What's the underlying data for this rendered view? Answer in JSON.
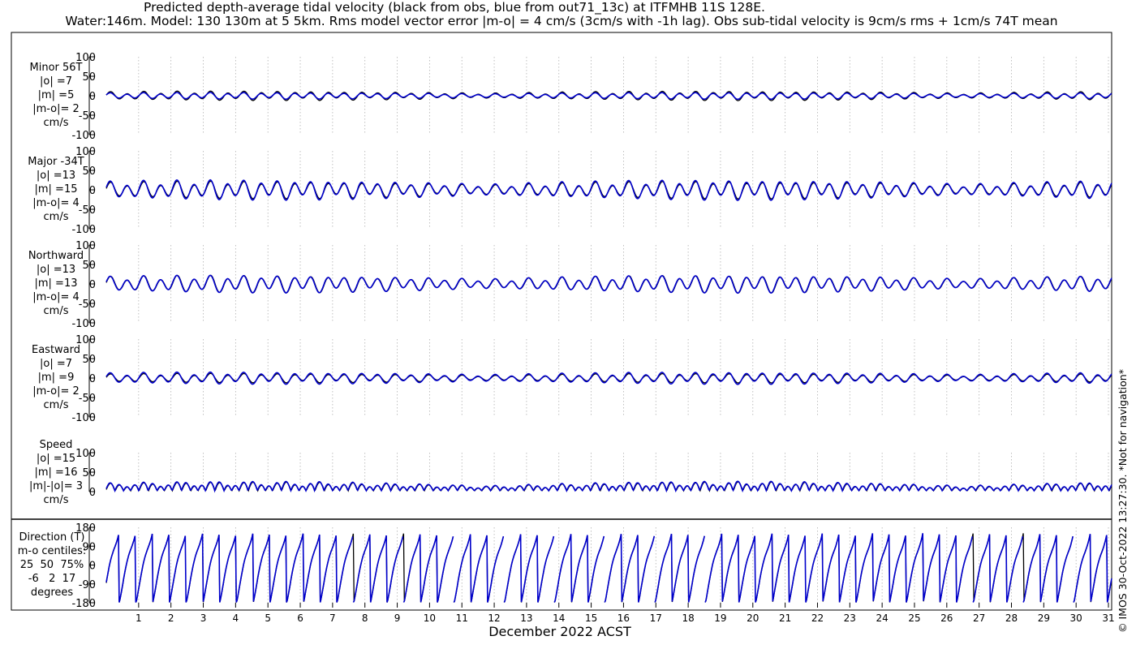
{
  "header": {
    "title_line1": "Predicted depth-average tidal velocity (black from obs, blue from out71_13c) at ITFMHB 11S 128E.",
    "title_line2": "Water:146m. Model: 130 130m at 5 5km. Rms model vector error |m-o| = 4 cm/s (3cm/s with -1h lag). Obs sub-tidal velocity is 9cm/s rms + 1cm/s 74T mean"
  },
  "xlabel": "December 2022 ACST",
  "copyright": "© IMOS 30-Oct-2022 13:27:30. *Not for navigation*",
  "colors": {
    "obs": "#000000",
    "model": "#0000cc",
    "grid": "#b0b0b0"
  },
  "chart_data": [
    {
      "type": "line",
      "id": "minor",
      "label_lines": [
        "Minor 56T",
        "|o| =7",
        "|m| =5",
        "|m-o|= 2",
        "cm/s"
      ],
      "ylim": [
        -100,
        100
      ],
      "yticks": [
        100,
        50,
        0,
        -50,
        -100
      ],
      "xlim": [
        0,
        31.1
      ],
      "xticks": [
        1,
        2,
        3,
        4,
        5,
        6,
        7,
        8,
        9,
        10,
        11,
        12,
        13,
        14,
        15,
        16,
        17,
        18,
        19,
        20,
        21,
        22,
        23,
        24,
        25,
        26,
        27,
        28,
        29,
        30,
        31
      ],
      "series": [
        {
          "name": "obs",
          "rms": 7
        },
        {
          "name": "model",
          "rms": 5
        }
      ]
    },
    {
      "type": "line",
      "id": "major",
      "label_lines": [
        "Major -34T",
        "|o| =13",
        "|m| =15",
        "|m-o|= 4",
        "cm/s"
      ],
      "ylim": [
        -100,
        100
      ],
      "yticks": [
        100,
        50,
        0,
        -50,
        -100
      ],
      "xlim": [
        0,
        31.1
      ],
      "xticks": [
        1,
        2,
        3,
        4,
        5,
        6,
        7,
        8,
        9,
        10,
        11,
        12,
        13,
        14,
        15,
        16,
        17,
        18,
        19,
        20,
        21,
        22,
        23,
        24,
        25,
        26,
        27,
        28,
        29,
        30,
        31
      ],
      "series": [
        {
          "name": "obs",
          "rms": 13
        },
        {
          "name": "model",
          "rms": 15
        }
      ]
    },
    {
      "type": "line",
      "id": "north",
      "label_lines": [
        "Northward",
        "|o| =13",
        "|m| =13",
        "|m-o|= 4",
        "cm/s"
      ],
      "ylim": [
        -100,
        100
      ],
      "yticks": [
        100,
        50,
        0,
        -50,
        -100
      ],
      "xlim": [
        0,
        31.1
      ],
      "xticks": [
        1,
        2,
        3,
        4,
        5,
        6,
        7,
        8,
        9,
        10,
        11,
        12,
        13,
        14,
        15,
        16,
        17,
        18,
        19,
        20,
        21,
        22,
        23,
        24,
        25,
        26,
        27,
        28,
        29,
        30,
        31
      ],
      "series": [
        {
          "name": "obs",
          "rms": 13
        },
        {
          "name": "model",
          "rms": 13
        }
      ]
    },
    {
      "type": "line",
      "id": "east",
      "label_lines": [
        "Eastward",
        "|o| =7",
        "|m| =9",
        "|m-o|= 2",
        "cm/s"
      ],
      "ylim": [
        -100,
        100
      ],
      "yticks": [
        100,
        50,
        0,
        -50,
        -100
      ],
      "xlim": [
        0,
        31.1
      ],
      "xticks": [
        1,
        2,
        3,
        4,
        5,
        6,
        7,
        8,
        9,
        10,
        11,
        12,
        13,
        14,
        15,
        16,
        17,
        18,
        19,
        20,
        21,
        22,
        23,
        24,
        25,
        26,
        27,
        28,
        29,
        30,
        31
      ],
      "series": [
        {
          "name": "obs",
          "rms": 7
        },
        {
          "name": "model",
          "rms": 9
        }
      ]
    },
    {
      "type": "line",
      "id": "speed",
      "label_lines": [
        "Speed",
        "|o| =15",
        "|m| =16",
        "|m|-|o|= 3",
        "cm/s"
      ],
      "ylim": [
        0,
        100
      ],
      "yticks": [
        100,
        50,
        0
      ],
      "xlim": [
        0,
        31.1
      ],
      "xticks": [
        1,
        2,
        3,
        4,
        5,
        6,
        7,
        8,
        9,
        10,
        11,
        12,
        13,
        14,
        15,
        16,
        17,
        18,
        19,
        20,
        21,
        22,
        23,
        24,
        25,
        26,
        27,
        28,
        29,
        30,
        31
      ],
      "series": [
        {
          "name": "obs",
          "rms": 15
        },
        {
          "name": "model",
          "rms": 16
        }
      ]
    },
    {
      "type": "line",
      "id": "dir",
      "label_lines": [
        "Direction (T)",
        "m-o centiles:",
        "25  50  75%",
        "-6   2  17",
        "degrees"
      ],
      "ylim": [
        -180,
        180
      ],
      "yticks": [
        180,
        90,
        0,
        -90,
        -180
      ],
      "xlim": [
        0,
        31.1
      ],
      "xticks": [
        1,
        2,
        3,
        4,
        5,
        6,
        7,
        8,
        9,
        10,
        11,
        12,
        13,
        14,
        15,
        16,
        17,
        18,
        19,
        20,
        21,
        22,
        23,
        24,
        25,
        26,
        27,
        28,
        29,
        30,
        31
      ],
      "series": [
        {
          "name": "obs"
        },
        {
          "name": "model"
        }
      ]
    }
  ]
}
